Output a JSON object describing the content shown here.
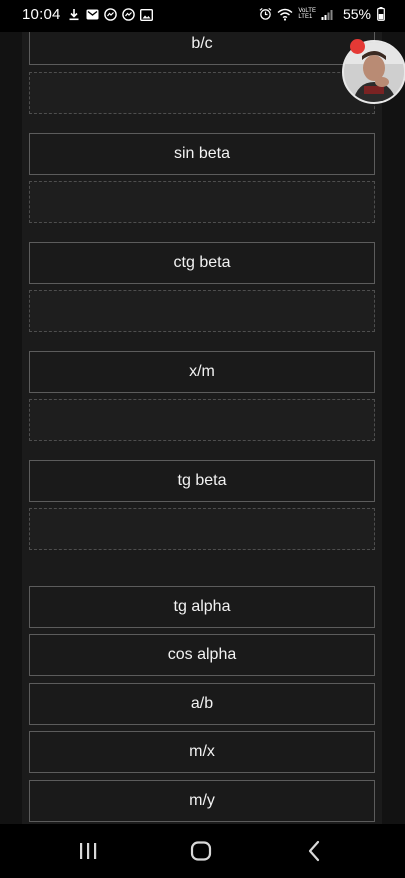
{
  "status_bar": {
    "time": "10:04",
    "battery_percent": "55%",
    "signal_label_top": "VoLTE",
    "signal_label_bottom": "LTE1"
  },
  "answers_top": [
    {
      "label": "b/c"
    },
    {
      "label": "sin beta"
    },
    {
      "label": "ctg beta"
    },
    {
      "label": "x/m"
    },
    {
      "label": "tg beta"
    }
  ],
  "answers_bottom": [
    {
      "label": "tg alpha"
    },
    {
      "label": "cos alpha"
    },
    {
      "label": "a/b"
    },
    {
      "label": "m/x"
    },
    {
      "label": "m/y"
    }
  ],
  "colors": {
    "background": "#121212",
    "panel": "#1b1b1b",
    "box_border": "#5c5c5c",
    "text": "#f2f2f2",
    "badge": "#e53935"
  },
  "icons": {
    "status_left": [
      "download-icon",
      "mail-icon",
      "messenger-icon",
      "messenger-icon",
      "image-icon"
    ],
    "status_right": [
      "alarm-icon",
      "wifi-icon",
      "signal-icon",
      "battery-icon"
    ],
    "nav": [
      "recent-apps-icon",
      "home-icon",
      "back-icon"
    ]
  }
}
